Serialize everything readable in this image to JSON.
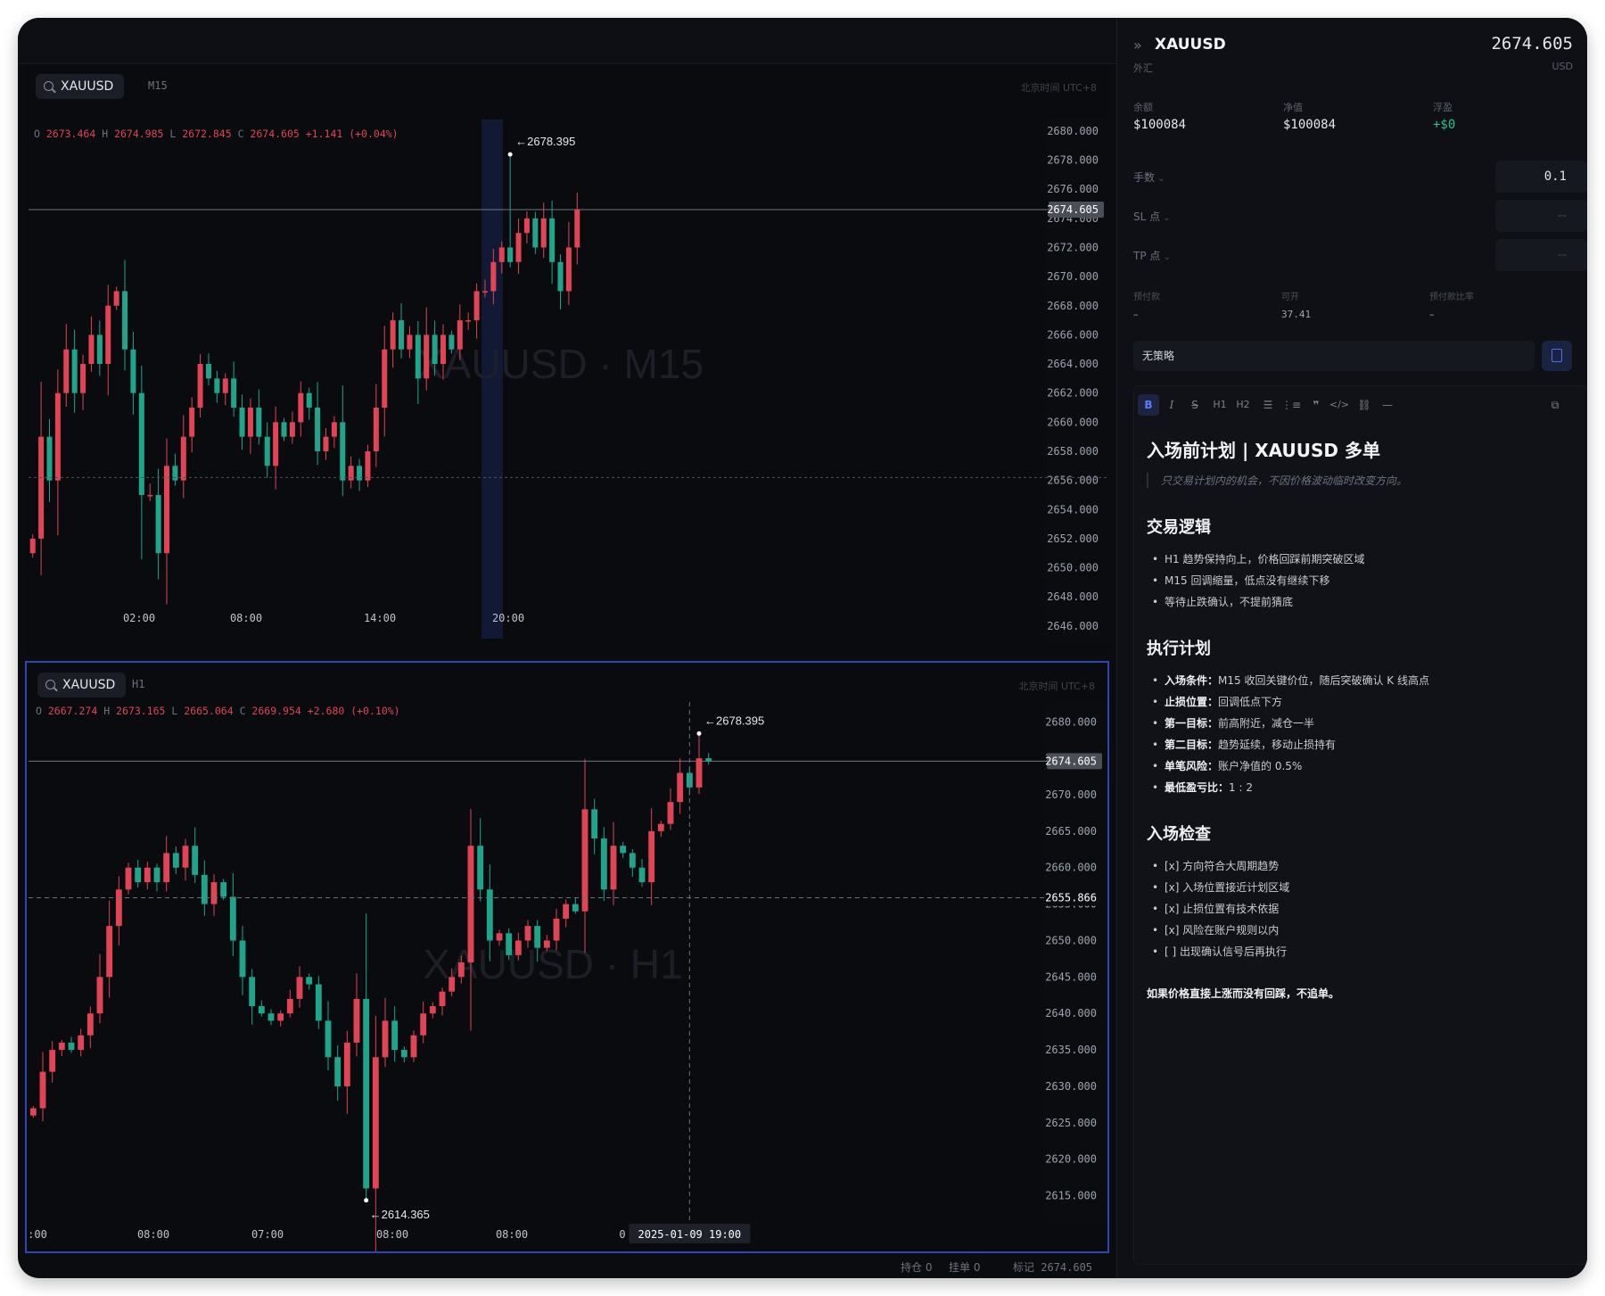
{
  "chart_top": {
    "symbol": "XAUUSD",
    "timeframe": "M15",
    "timezone_label": "北京时间 UTC+8",
    "watermark": "XAUUSD · M15",
    "ohlc": {
      "o_label": "O",
      "o": "2673.464",
      "h_label": "H",
      "h": "2674.985",
      "l_label": "L",
      "l": "2672.845",
      "c_label": "C",
      "c": "2674.605",
      "change": "+1.141 (+0.04%)"
    },
    "peak_label": "←2678.395",
    "last_price_tag": "2674.605"
  },
  "chart_bottom": {
    "symbol": "XAUUSD",
    "timeframe": "H1",
    "timezone_label": "北京时间 UTC+8",
    "watermark": "XAUUSD · H1",
    "ohlc": {
      "o_label": "O",
      "o": "2667.274",
      "h_label": "H",
      "h": "2673.165",
      "l_label": "L",
      "l": "2665.064",
      "c_label": "C",
      "c": "2669.954",
      "change": "+2.680 (+0.10%)"
    },
    "peak_label": "←2678.395",
    "low_label": "←2614.365",
    "last_price_tag": "2674.605",
    "crosshair_price_tag": "2655.866",
    "crosshair_time": "2025-01-09 19:00"
  },
  "chart_data": [
    {
      "type": "candlestick",
      "title": "XAUUSD M15",
      "y_ticks": [
        "2680.000",
        "2678.000",
        "2676.000",
        "2674.000",
        "2672.000",
        "2670.000",
        "2668.000",
        "2666.000",
        "2664.000",
        "2662.000",
        "2660.000",
        "2658.000",
        "2656.000",
        "2654.000",
        "2652.000",
        "2650.000",
        "2648.000",
        "2646.000"
      ],
      "x_ticks": [
        "02:00",
        "08:00",
        "14:00",
        "20:00"
      ],
      "ylim": [
        2645.5,
        2680.3
      ],
      "last_price": 2674.605,
      "high_marker": 2678.395,
      "close_path": [
        2652,
        2659,
        2656,
        2662,
        2665,
        2662,
        2664,
        2666,
        2664,
        2668,
        2669,
        2665,
        2662,
        2655,
        2655,
        2651,
        2657,
        2656,
        2659,
        2661,
        2664,
        2663,
        2662,
        2663,
        2661,
        2659,
        2661,
        2659,
        2657,
        2660,
        2659,
        2660,
        2662,
        2661,
        2658,
        2659,
        2660,
        2656,
        2657,
        2656,
        2658,
        2661,
        2665,
        2667,
        2665,
        2666,
        2663,
        2666,
        2664,
        2666,
        2665,
        2667,
        2667,
        2669,
        2669,
        2671,
        2672,
        2671,
        2673,
        2674,
        2672,
        2674,
        2671,
        2669,
        2672,
        2674.6
      ]
    },
    {
      "type": "candlestick",
      "title": "XAUUSD H1",
      "y_ticks": [
        "2680.000",
        "2675.000",
        "2670.000",
        "2665.000",
        "2660.000",
        "2655.000",
        "2650.000",
        "2645.000",
        "2640.000",
        "2635.000",
        "2630.000",
        "2625.000",
        "2620.000",
        "2615.000"
      ],
      "x_ticks": [
        ":00",
        "08:00",
        "07:00",
        "08:00",
        "08:00",
        "0"
      ],
      "ylim": [
        2612.5,
        2681.5
      ],
      "last_price": 2674.605,
      "crosshair_price": 2655.866,
      "high_marker": 2678.395,
      "low_marker": 2614.365,
      "close_path": [
        2627,
        2632,
        2635,
        2636,
        2635,
        2637,
        2640,
        2645,
        2652,
        2657,
        2660,
        2658,
        2660,
        2658,
        2662,
        2660,
        2663,
        2659,
        2655,
        2658,
        2656,
        2650,
        2645,
        2641,
        2640,
        2639,
        2640,
        2642,
        2645,
        2644,
        2639,
        2634,
        2630,
        2636,
        2642,
        2616,
        2634,
        2639,
        2635,
        2634,
        2637,
        2640,
        2641,
        2643,
        2645,
        2647,
        2663,
        2657,
        2650,
        2651,
        2648,
        2650,
        2652,
        2649,
        2650,
        2653,
        2655,
        2654,
        2668,
        2664,
        2657,
        2663,
        2662,
        2660,
        2658,
        2665,
        2666,
        2669,
        2673,
        2671,
        2675,
        2674.6
      ]
    }
  ],
  "status": {
    "positions": "持仓 0",
    "orders": "挂单 0",
    "mark": "标记 2674.605"
  },
  "side": {
    "symbol": "XAUUSD",
    "category": "外汇",
    "price": "2674.605",
    "currency": "USD",
    "account": [
      {
        "label": "余额",
        "value": "$100084"
      },
      {
        "label": "净值",
        "value": "$100084"
      },
      {
        "label": "浮盈",
        "value": "+$0"
      }
    ],
    "lots_label": "手数",
    "lots_value": "0.1",
    "sl_label": "SL 点",
    "sl_value": "--",
    "tp_label": "TP 点",
    "tp_value": "--",
    "metrics": [
      {
        "label": "预付款",
        "value": "–"
      },
      {
        "label": "可开",
        "value": "37.41"
      },
      {
        "label": "预付款比率",
        "value": "–"
      }
    ],
    "strategy": "无策略",
    "toolbar": [
      "B",
      "I",
      "S",
      "H1",
      "H2",
      "list",
      "ordered-list",
      "quote",
      "code",
      "link",
      "rule"
    ],
    "note": {
      "title": "入场前计划 | XAUUSD 多单",
      "quote": "只交易计划内的机会，不因价格波动临时改变方向。",
      "s1_title": "交易逻辑",
      "s1_items": [
        "H1 趋势保持向上，价格回踩前期突破区域",
        "M15 回调缩量，低点没有继续下移",
        "等待止跌确认，不提前猜底"
      ],
      "s2_title": "执行计划",
      "s2_items": [
        {
          "k": "入场条件：",
          "v": "M15 收回关键价位，随后突破确认 K 线高点"
        },
        {
          "k": "止损位置：",
          "v": "回调低点下方"
        },
        {
          "k": "第一目标：",
          "v": "前高附近，减仓一半"
        },
        {
          "k": "第二目标：",
          "v": "趋势延续，移动止损持有"
        },
        {
          "k": "单笔风险：",
          "v": "账户净值的 0.5%"
        },
        {
          "k": "最低盈亏比：",
          "v": "1 : 2"
        }
      ],
      "s3_title": "入场检查",
      "s3_items": [
        "[x] 方向符合大周期趋势",
        "[x] 入场位置接近计划区域",
        "[x] 止损位置有技术依据",
        "[x] 风险在账户规则以内",
        "[ ] 出现确认信号后再执行"
      ],
      "final": "如果价格直接上涨而没有回踩，不追单。"
    }
  },
  "colors": {
    "up": "#e04455",
    "down": "#1fa58c",
    "accent": "#2d46b4",
    "profit": "#26c281"
  }
}
